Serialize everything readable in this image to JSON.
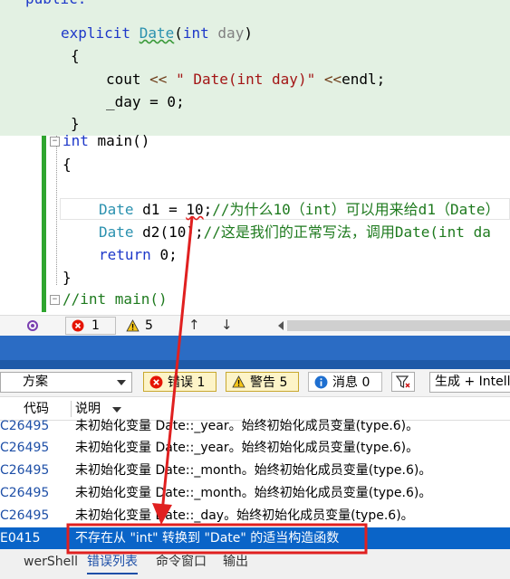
{
  "code": {
    "top_partial": "public:",
    "ctor_explicit": "explicit",
    "ctor_name": "Date",
    "ctor_open": "(",
    "ctor_type": "int",
    "ctor_param": "day",
    "ctor_close": ")",
    "brace_open": "{",
    "cout_kw": "cout",
    "cout_op1": "<<",
    "cout_str": "\" Date(int day)\"",
    "cout_op2": "<<",
    "cout_endl": "endl;",
    "day_assign": "_day = 0;",
    "brace_close": "}",
    "main_kw": "int",
    "main_name": "main()",
    "main_brace_open": "{",
    "d1_type": "Date",
    "d1_rest": "d1 = ",
    "d1_val": "10",
    "d1_semicolon": ";",
    "d1_comment": "//为什么10（int）可以用来给d1（Date）",
    "d2_type": "Date",
    "d2_rest": "d2(10);",
    "d2_comment": "//这是我们的正常写法，调用Date(int da",
    "return_kw": "return",
    "return_rest": "0;",
    "main_brace_close": "}",
    "commented_main": "//int main()"
  },
  "status": {
    "error_count": "1",
    "warning_count": "5",
    "up_arrow": "↑",
    "down_arrow": "↓"
  },
  "filter_bar": {
    "scope": "方案",
    "errors_label": "错误 1",
    "warnings_label": "警告 5",
    "messages_label": "消息 0",
    "build_option": "生成 + Intell"
  },
  "columns": {
    "code": "代码",
    "description": "说明"
  },
  "rows": [
    {
      "code": "C26495",
      "desc": "未初始化变量 Date::_year。始终初始化成员变量(type.6)。"
    },
    {
      "code": "C26495",
      "desc": "未初始化变量 Date::_year。始终初始化成员变量(type.6)。"
    },
    {
      "code": "C26495",
      "desc": "未初始化变量 Date::_month。始终初始化成员变量(type.6)。"
    },
    {
      "code": "C26495",
      "desc": "未初始化变量 Date::_month。始终初始化成员变量(type.6)。"
    },
    {
      "code": "C26495",
      "desc": "未初始化变量 Date::_day。始终初始化成员变量(type.6)。"
    },
    {
      "code": "E0415",
      "desc": "不存在从 \"int\" 转换到 \"Date\" 的适当构造函数"
    }
  ],
  "bottom_tabs": {
    "powershell": "werShell",
    "error_list": "错误列表",
    "command_window": "命令窗口",
    "output": "输出"
  },
  "colors": {
    "annotation_red": "#e02020",
    "selection_blue": "#0a64c8",
    "code_highlight": "#e3f1e3"
  }
}
